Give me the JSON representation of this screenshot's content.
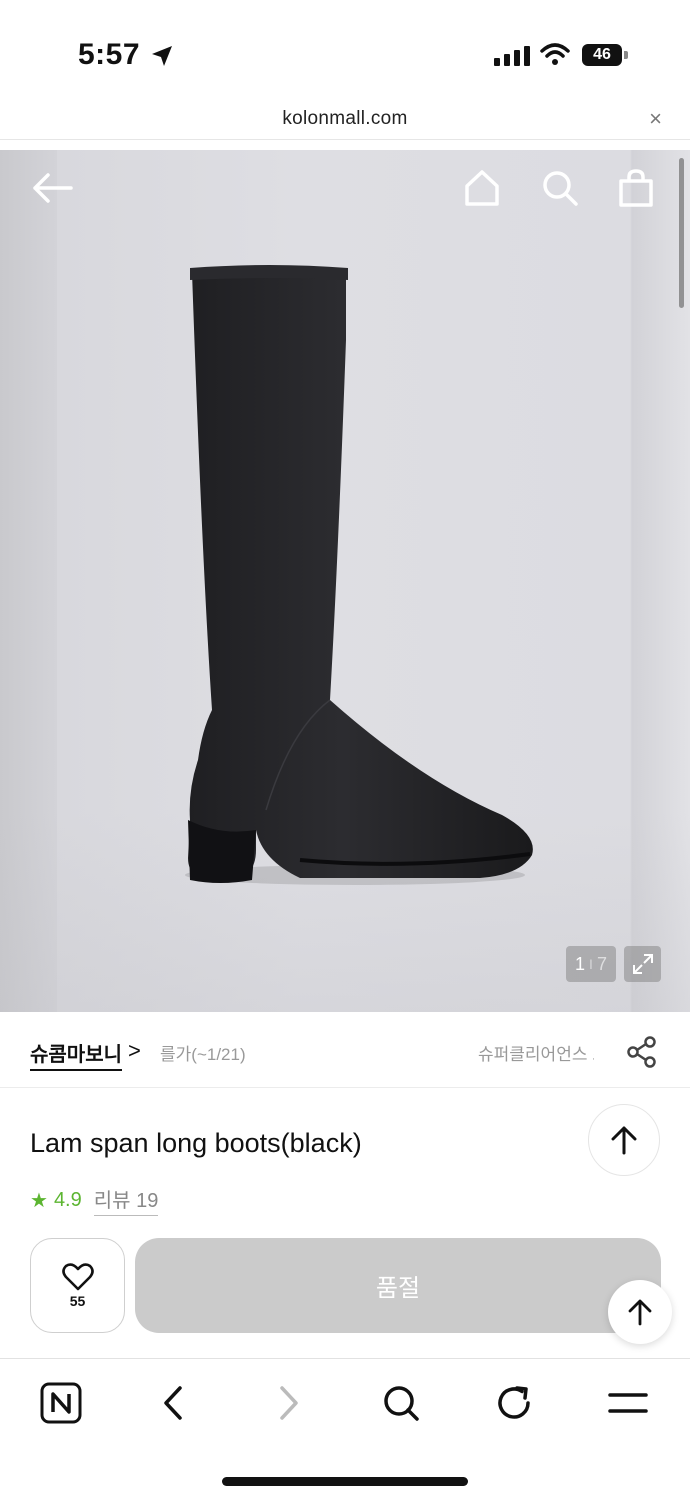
{
  "status_bar": {
    "time": "5:57",
    "battery": "46"
  },
  "url_bar": {
    "domain": "kolonmall.com",
    "close_glyph": "×"
  },
  "product_image": {
    "current": "1",
    "separator": "I",
    "total": "7",
    "scroll_position": 0.0
  },
  "brand_row": {
    "brand": "슈콤마보니",
    "chevron": ">",
    "promo_left": "를가(~1/21)",
    "promo_right": "슈퍼클리어언스 초"
  },
  "product": {
    "title": "Lam span long boots(black)",
    "star": "★",
    "rating": "4.9",
    "review_label": "리뷰 19"
  },
  "actions": {
    "like_count": "55",
    "soldout_label": "품절"
  },
  "icons": {
    "back": "arrow-left-icon",
    "home": "home-icon",
    "search": "search-icon",
    "bag": "shopping-bag-icon",
    "share": "share-icon",
    "heart": "heart-icon",
    "scroll_top": "arrow-up-icon",
    "naver": "naver-n-icon",
    "browser_back": "chevron-left-icon",
    "browser_forward": "chevron-right-icon",
    "reload": "reload-icon",
    "menu": "menu-icon"
  },
  "colors": {
    "accent_green": "#5cb531",
    "soldout_gray": "#cbcbcb"
  }
}
